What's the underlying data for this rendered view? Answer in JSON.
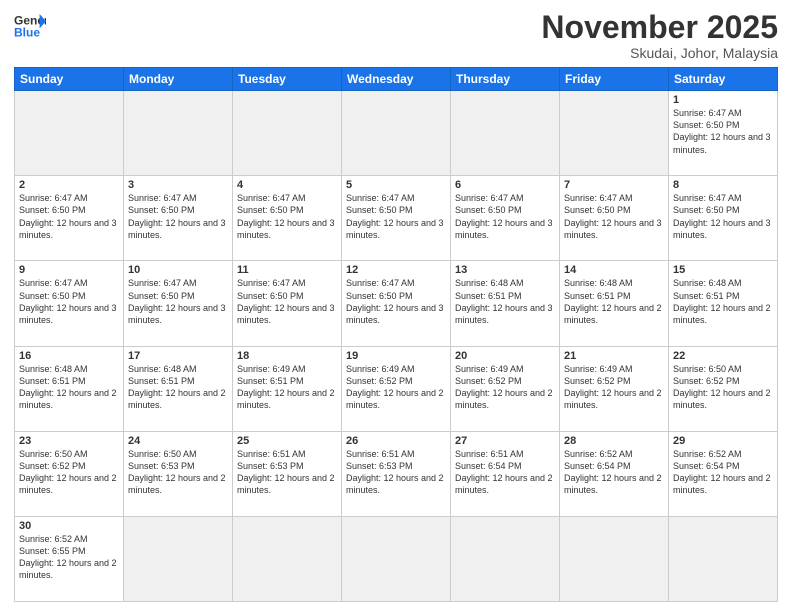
{
  "header": {
    "logo_general": "General",
    "logo_blue": "Blue",
    "month_title": "November 2025",
    "location": "Skudai, Johor, Malaysia"
  },
  "weekdays": [
    "Sunday",
    "Monday",
    "Tuesday",
    "Wednesday",
    "Thursday",
    "Friday",
    "Saturday"
  ],
  "weeks": [
    [
      {
        "day": "",
        "empty": true
      },
      {
        "day": "",
        "empty": true
      },
      {
        "day": "",
        "empty": true
      },
      {
        "day": "",
        "empty": true
      },
      {
        "day": "",
        "empty": true
      },
      {
        "day": "",
        "empty": true
      },
      {
        "day": "1",
        "sunrise": "6:47 AM",
        "sunset": "6:50 PM",
        "daylight": "12 hours and 3 minutes."
      }
    ],
    [
      {
        "day": "2",
        "sunrise": "6:47 AM",
        "sunset": "6:50 PM",
        "daylight": "12 hours and 3 minutes."
      },
      {
        "day": "3",
        "sunrise": "6:47 AM",
        "sunset": "6:50 PM",
        "daylight": "12 hours and 3 minutes."
      },
      {
        "day": "4",
        "sunrise": "6:47 AM",
        "sunset": "6:50 PM",
        "daylight": "12 hours and 3 minutes."
      },
      {
        "day": "5",
        "sunrise": "6:47 AM",
        "sunset": "6:50 PM",
        "daylight": "12 hours and 3 minutes."
      },
      {
        "day": "6",
        "sunrise": "6:47 AM",
        "sunset": "6:50 PM",
        "daylight": "12 hours and 3 minutes."
      },
      {
        "day": "7",
        "sunrise": "6:47 AM",
        "sunset": "6:50 PM",
        "daylight": "12 hours and 3 minutes."
      },
      {
        "day": "8",
        "sunrise": "6:47 AM",
        "sunset": "6:50 PM",
        "daylight": "12 hours and 3 minutes."
      }
    ],
    [
      {
        "day": "9",
        "sunrise": "6:47 AM",
        "sunset": "6:50 PM",
        "daylight": "12 hours and 3 minutes."
      },
      {
        "day": "10",
        "sunrise": "6:47 AM",
        "sunset": "6:50 PM",
        "daylight": "12 hours and 3 minutes."
      },
      {
        "day": "11",
        "sunrise": "6:47 AM",
        "sunset": "6:50 PM",
        "daylight": "12 hours and 3 minutes."
      },
      {
        "day": "12",
        "sunrise": "6:47 AM",
        "sunset": "6:50 PM",
        "daylight": "12 hours and 3 minutes."
      },
      {
        "day": "13",
        "sunrise": "6:48 AM",
        "sunset": "6:51 PM",
        "daylight": "12 hours and 3 minutes."
      },
      {
        "day": "14",
        "sunrise": "6:48 AM",
        "sunset": "6:51 PM",
        "daylight": "12 hours and 2 minutes."
      },
      {
        "day": "15",
        "sunrise": "6:48 AM",
        "sunset": "6:51 PM",
        "daylight": "12 hours and 2 minutes."
      }
    ],
    [
      {
        "day": "16",
        "sunrise": "6:48 AM",
        "sunset": "6:51 PM",
        "daylight": "12 hours and 2 minutes."
      },
      {
        "day": "17",
        "sunrise": "6:48 AM",
        "sunset": "6:51 PM",
        "daylight": "12 hours and 2 minutes."
      },
      {
        "day": "18",
        "sunrise": "6:49 AM",
        "sunset": "6:51 PM",
        "daylight": "12 hours and 2 minutes."
      },
      {
        "day": "19",
        "sunrise": "6:49 AM",
        "sunset": "6:52 PM",
        "daylight": "12 hours and 2 minutes."
      },
      {
        "day": "20",
        "sunrise": "6:49 AM",
        "sunset": "6:52 PM",
        "daylight": "12 hours and 2 minutes."
      },
      {
        "day": "21",
        "sunrise": "6:49 AM",
        "sunset": "6:52 PM",
        "daylight": "12 hours and 2 minutes."
      },
      {
        "day": "22",
        "sunrise": "6:50 AM",
        "sunset": "6:52 PM",
        "daylight": "12 hours and 2 minutes."
      }
    ],
    [
      {
        "day": "23",
        "sunrise": "6:50 AM",
        "sunset": "6:52 PM",
        "daylight": "12 hours and 2 minutes."
      },
      {
        "day": "24",
        "sunrise": "6:50 AM",
        "sunset": "6:53 PM",
        "daylight": "12 hours and 2 minutes."
      },
      {
        "day": "25",
        "sunrise": "6:51 AM",
        "sunset": "6:53 PM",
        "daylight": "12 hours and 2 minutes."
      },
      {
        "day": "26",
        "sunrise": "6:51 AM",
        "sunset": "6:53 PM",
        "daylight": "12 hours and 2 minutes."
      },
      {
        "day": "27",
        "sunrise": "6:51 AM",
        "sunset": "6:54 PM",
        "daylight": "12 hours and 2 minutes."
      },
      {
        "day": "28",
        "sunrise": "6:52 AM",
        "sunset": "6:54 PM",
        "daylight": "12 hours and 2 minutes."
      },
      {
        "day": "29",
        "sunrise": "6:52 AM",
        "sunset": "6:54 PM",
        "daylight": "12 hours and 2 minutes."
      }
    ],
    [
      {
        "day": "30",
        "sunrise": "6:52 AM",
        "sunset": "6:55 PM",
        "daylight": "12 hours and 2 minutes."
      },
      {
        "day": "",
        "empty": true
      },
      {
        "day": "",
        "empty": true
      },
      {
        "day": "",
        "empty": true
      },
      {
        "day": "",
        "empty": true
      },
      {
        "day": "",
        "empty": true
      },
      {
        "day": "",
        "empty": true
      }
    ]
  ]
}
